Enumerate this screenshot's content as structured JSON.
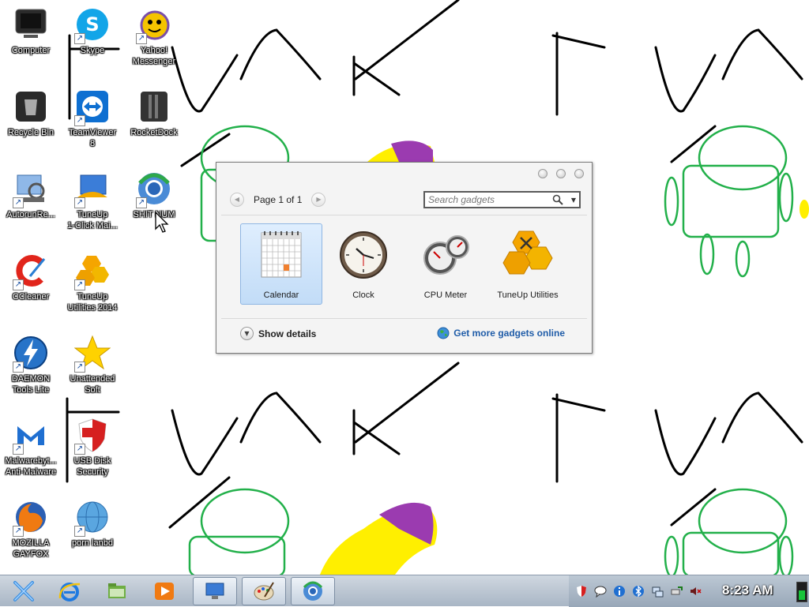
{
  "desktop": {
    "icons": [
      {
        "label": "Computer",
        "icon": "computer-icon"
      },
      {
        "label": "Skype",
        "icon": "skype-icon"
      },
      {
        "label": "Yahoo!\nMessenger",
        "icon": "yahoo-messenger-icon"
      },
      {
        "label": "Recycle Bin",
        "icon": "recycle-bin-icon"
      },
      {
        "label": "TeamViewer\n8",
        "icon": "teamviewer-icon"
      },
      {
        "label": "RocketDock",
        "icon": "rocketdock-icon"
      },
      {
        "label": "AutorunRe...",
        "icon": "autorun-icon"
      },
      {
        "label": "TuneUp\n1-Click Mai...",
        "icon": "tuneup-1click-icon"
      },
      {
        "label": "SHIT NUM",
        "icon": "chrome-like-icon"
      },
      {
        "label": "CCleaner",
        "icon": "ccleaner-icon"
      },
      {
        "label": "TuneUp\nUtilities 2014",
        "icon": "tuneup-utilities-icon"
      },
      {
        "label": "DAEMON\nTools Lite",
        "icon": "daemon-tools-icon"
      },
      {
        "label": "Unattended\nSoft",
        "icon": "star-icon"
      },
      {
        "label": "Malwarebyt...\nAnti-Malware",
        "icon": "malwarebytes-icon"
      },
      {
        "label": "USB Disk\nSecurity",
        "icon": "usb-disk-security-icon"
      },
      {
        "label": "MOZILLA\nGAYFOX",
        "icon": "firefox-icon"
      },
      {
        "label": "porn lanbd",
        "icon": "globe-icon"
      }
    ]
  },
  "gadget_window": {
    "page_text": "Page 1 of 1",
    "search_placeholder": "Search gadgets",
    "gadgets": [
      {
        "label": "Calendar",
        "icon": "calendar-icon",
        "selected": true
      },
      {
        "label": "Clock",
        "icon": "clock-icon",
        "selected": false
      },
      {
        "label": "CPU Meter",
        "icon": "cpu-meter-icon",
        "selected": false
      },
      {
        "label": "TuneUp Utilities",
        "icon": "tuneup-gadget-icon",
        "selected": false
      }
    ],
    "show_details": "Show details",
    "get_more": "Get more gadgets online"
  },
  "taskbar": {
    "clock": "8:23 AM",
    "buttons": [
      "start-icon",
      "internet-explorer-icon",
      "file-manager-icon",
      "media-player-icon",
      "display-icon",
      "paint-icon",
      "gadgets-icon"
    ]
  },
  "colors": {
    "taskbar_top": "#cfd7e0",
    "taskbar_bottom": "#a9b6c5",
    "link_blue": "#1f5ca8",
    "selected_gadget": "#c2dcf7",
    "android_green": "#22b04a",
    "wallpaper_yellow": "#ffef00",
    "wallpaper_purple": "#9b3bb0"
  }
}
